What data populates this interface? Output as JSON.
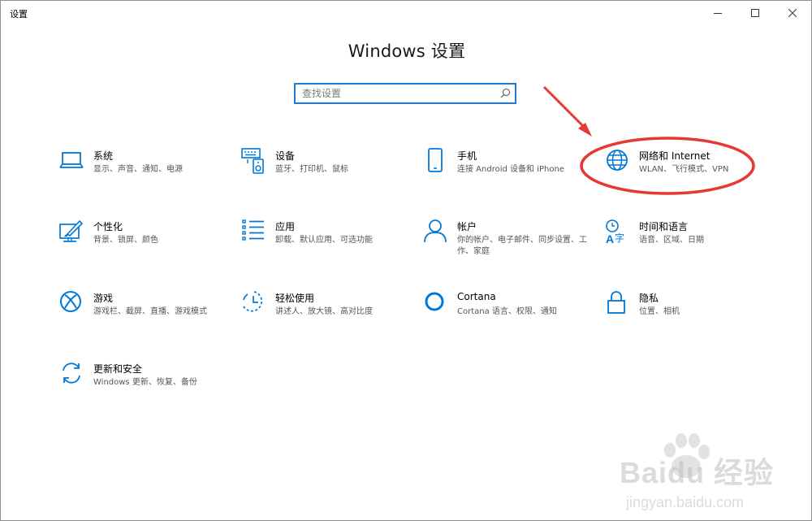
{
  "window": {
    "title": "设置",
    "controls": {
      "minimize": "minimize-icon",
      "maximize": "maximize-icon",
      "close": "close-icon"
    }
  },
  "page": {
    "title": "Windows 设置"
  },
  "search": {
    "placeholder": "查找设置",
    "value": ""
  },
  "accent_color": "#0078d7",
  "annotation_color": "#e53935",
  "tiles": [
    {
      "key": "system",
      "icon": "laptop-icon",
      "title": "系统",
      "desc": "显示、声音、通知、电源"
    },
    {
      "key": "devices",
      "icon": "devices-icon",
      "title": "设备",
      "desc": "蓝牙、打印机、鼠标"
    },
    {
      "key": "phone",
      "icon": "phone-icon",
      "title": "手机",
      "desc": "连接 Android 设备和 iPhone"
    },
    {
      "key": "network",
      "icon": "globe-icon",
      "title": "网络和 Internet",
      "desc": "WLAN、飞行模式、VPN"
    },
    {
      "key": "personalization",
      "icon": "paintbrush-icon",
      "title": "个性化",
      "desc": "背景、锁屏、颜色"
    },
    {
      "key": "apps",
      "icon": "apps-list-icon",
      "title": "应用",
      "desc": "卸载、默认应用、可选功能"
    },
    {
      "key": "accounts",
      "icon": "person-icon",
      "title": "帐户",
      "desc": "你的帐户、电子邮件、同步设置、工作、家庭"
    },
    {
      "key": "time-language",
      "icon": "time-language-icon",
      "title": "时间和语言",
      "desc": "语音、区域、日期"
    },
    {
      "key": "gaming",
      "icon": "xbox-icon",
      "title": "游戏",
      "desc": "游戏栏、截屏、直播、游戏模式"
    },
    {
      "key": "ease-of-access",
      "icon": "ease-of-access-icon",
      "title": "轻松使用",
      "desc": "讲述人、放大镜、高对比度"
    },
    {
      "key": "cortana",
      "icon": "cortana-icon",
      "title": "Cortana",
      "desc": "Cortana 语言、权限、通知"
    },
    {
      "key": "privacy",
      "icon": "lock-icon",
      "title": "隐私",
      "desc": "位置、相机"
    },
    {
      "key": "update-security",
      "icon": "sync-icon",
      "title": "更新和安全",
      "desc": "Windows 更新、恢复、备份"
    }
  ],
  "watermark": {
    "brand": "Baidu 经验",
    "site": "jingyan.baidu.com"
  }
}
